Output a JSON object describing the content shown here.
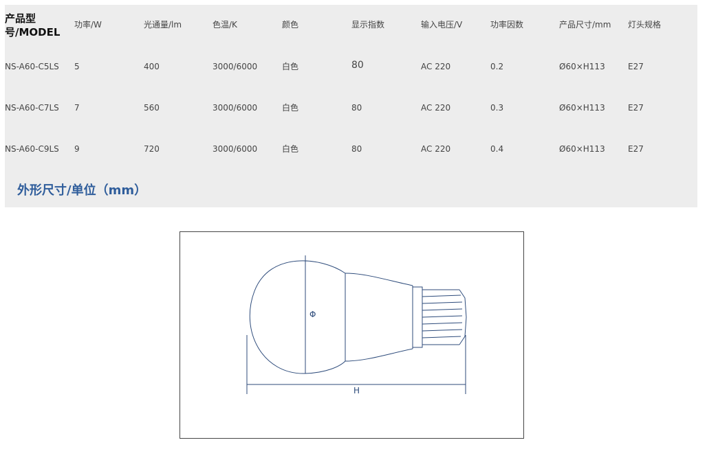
{
  "table": {
    "headers": {
      "model": "产品型号/MODEL",
      "power": "功率/W",
      "flux": "光通量/lm",
      "cct": "色温/K",
      "color": "颜色",
      "cri": "显示指数",
      "voltage": "输入电压/V",
      "pf": "功率因数",
      "size": "产品尺寸/mm",
      "base": "灯头规格"
    },
    "rows": [
      {
        "model": "NS-A60-C5LS",
        "power": "5",
        "flux": "400",
        "cct": "3000/6000",
        "color": "白色",
        "cri": "80",
        "voltage": "AC 220",
        "pf": "0.2",
        "size": "Ø60×H113",
        "base": "E27"
      },
      {
        "model": "NS-A60-C7LS",
        "power": "7",
        "flux": "560",
        "cct": "3000/6000",
        "color": "白色",
        "cri": "80",
        "voltage": "AC 220",
        "pf": "0.3",
        "size": "Ø60×H113",
        "base": "E27"
      },
      {
        "model": "NS-A60-C9LS",
        "power": "9",
        "flux": "720",
        "cct": "3000/6000",
        "color": "白色",
        "cri": "80",
        "voltage": "AC 220",
        "pf": "0.4",
        "size": "Ø60×H113",
        "base": "E27"
      }
    ]
  },
  "dimensions": {
    "title": "外形尺寸/单位（mm）",
    "diameter_label": "Φ",
    "height_label": "H"
  },
  "colors": {
    "panel_bg": "#ededed",
    "title_blue": "#2f5d9b",
    "drawing_line": "#2c4a7a"
  }
}
